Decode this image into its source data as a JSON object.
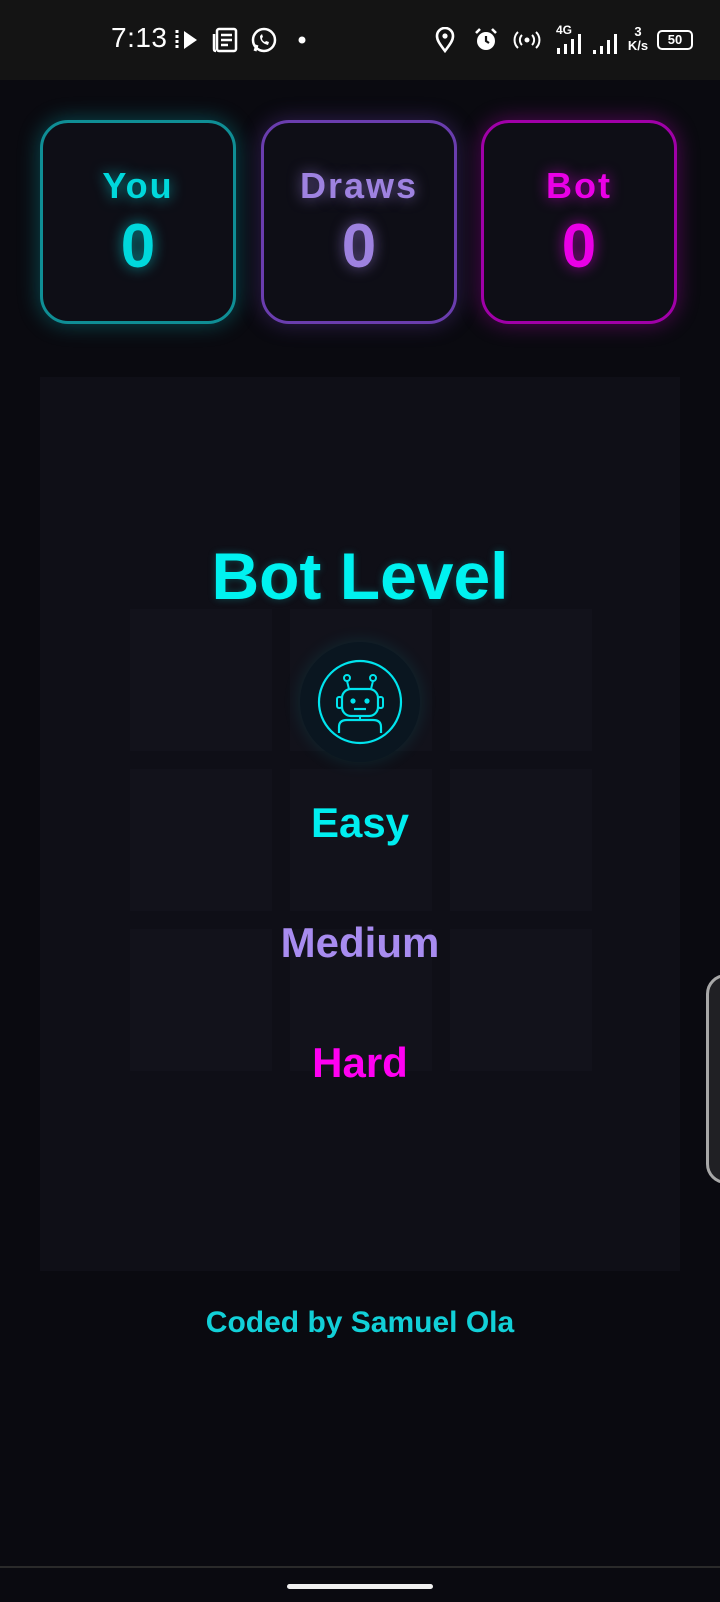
{
  "status_bar": {
    "time": "7:13",
    "network_type": "4G",
    "speed_value": "3",
    "speed_unit": "K/s",
    "battery": "50",
    "icons": [
      "media-icon",
      "news-icon",
      "whatsapp-icon",
      "dot-icon",
      "location-icon",
      "alarm-icon",
      "hotspot-icon",
      "signal-icon",
      "signal-icon-2",
      "battery-icon"
    ]
  },
  "scores": {
    "you": {
      "label": "You",
      "value": "0"
    },
    "draws": {
      "label": "Draws",
      "value": "0"
    },
    "bot": {
      "label": "Bot",
      "value": "0"
    }
  },
  "level_menu": {
    "title": "Bot Level",
    "icon": "robot-icon",
    "options": [
      {
        "label": "Easy"
      },
      {
        "label": "Medium"
      },
      {
        "label": "Hard"
      }
    ]
  },
  "footer": {
    "credit": "Coded by Samuel Ola"
  },
  "colors": {
    "cyan": "#00eef0",
    "purple": "#a88cf0",
    "magenta": "#ff00f2",
    "background": "#0a0a10"
  }
}
